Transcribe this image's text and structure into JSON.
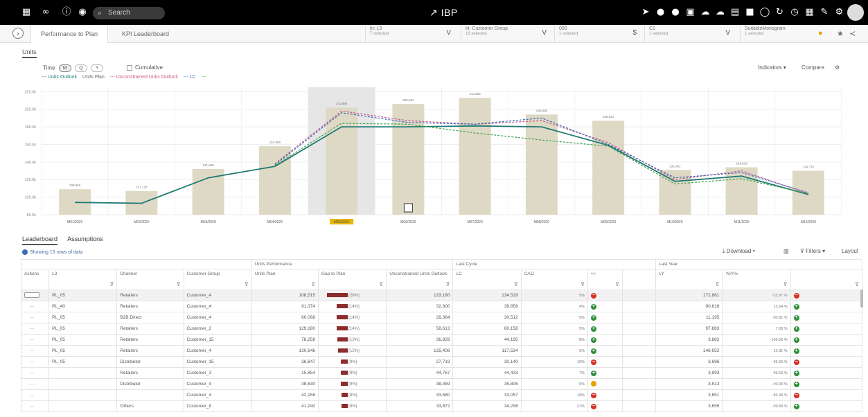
{
  "topbar": {
    "search_placeholder": "Search",
    "app_name": "IBP",
    "left_icons": [
      "grid-icon",
      "link-icon",
      "info-icon",
      "target-icon"
    ],
    "right_icons": [
      "send-icon",
      "circle-icon",
      "circle-icon",
      "doc-icon",
      "cloud-icon",
      "cloud-upload-icon",
      "file-icon",
      "screen-icon",
      "chat-icon",
      "refresh-icon",
      "clock-icon",
      "save-icon",
      "edit-icon",
      "settings-icon"
    ]
  },
  "tabs": [
    {
      "label": "Performance to Plan"
    },
    {
      "label": "KPI Leaderboard"
    }
  ],
  "filters": [
    {
      "label": "kt: L3",
      "value": "7 selected",
      "sym": "V"
    },
    {
      "label": "kt: Customer Group",
      "value": "18 selected",
      "sym": "V"
    },
    {
      "label": "000",
      "value": "1 selected",
      "sym": "$"
    },
    {
      "label": "C1",
      "value": "1 selected",
      "sym": "V"
    },
    {
      "label": "SuitableMonogram",
      "value": "1 selected",
      "sym": ""
    }
  ],
  "chart_section": {
    "tab": "Units",
    "time_label": "Time",
    "time_buttons": [
      "M",
      "Q",
      "Y"
    ],
    "cumulative": "Cumulative",
    "indicators": "Indicators",
    "compare": "Compare"
  },
  "legend": [
    "--- Units Outlook",
    "Units Plan",
    "--- Unconstrained Units Outlook",
    "--- LC",
    "---"
  ],
  "chart_data": {
    "type": "bar",
    "categories": [
      "M01/2020",
      "M02/2020",
      "M03/2020",
      "M04/2020",
      "M05/2020",
      "M06/2020",
      "M07/2020",
      "M08/2020",
      "M09/2020",
      "M10/2020",
      "M11/2020",
      "M12/2020"
    ],
    "bar_labels": [
      "108,960",
      "107,128",
      "131,885",
      "157,908",
      "201,888",
      "205,822",
      "212,554",
      "193,809",
      "186,821",
      "131,091",
      "133,618",
      "129,776"
    ],
    "ylim": [
      80,
      225
    ],
    "y_ticks": [
      "80.0k",
      "100.0k",
      "120.0k",
      "140.0k",
      "160.0k",
      "180.0k",
      "200.0k",
      "220.0k"
    ],
    "series": [
      {
        "name": "Units Plan",
        "values": [
          109,
          107,
          132,
          158,
          202,
          206,
          213,
          194,
          187,
          131,
          134,
          130
        ]
      },
      {
        "name": "Units Outlook",
        "values": [
          94,
          93,
          122,
          135,
          180,
          180,
          181,
          180,
          159,
          118,
          124,
          103
        ]
      },
      {
        "name": "Unconstrained Units Outlook",
        "values": [
          null,
          null,
          null,
          138,
          198,
          187,
          183,
          187,
          162,
          120,
          130,
          104
        ]
      },
      {
        "name": "LC",
        "values": [
          null,
          null,
          null,
          137,
          196,
          185,
          183,
          190,
          160,
          122,
          128,
          105
        ]
      },
      {
        "name": "",
        "values": [
          null,
          null,
          null,
          136,
          184,
          183,
          173,
          165,
          158,
          115,
          121,
          104
        ]
      }
    ],
    "highlight": "M05/2020",
    "colors": {
      "bar": "#ded9c5",
      "outlook": "#1f7a72",
      "unconstrained": "#c8578a",
      "lc": "#3b6ab8",
      "extra": "#3fa34d"
    }
  },
  "table_section": {
    "tabs": [
      "Leaderboard",
      "Assumptions"
    ],
    "showing": "Showing 15 rows of data",
    "download": "Download",
    "filters": "Filters",
    "layout": "Layout"
  },
  "table": {
    "groups": [
      "",
      "",
      "",
      "",
      "Units Performance",
      "",
      "",
      "Last Cycle",
      "",
      "",
      "",
      "Last Year",
      "",
      ""
    ],
    "columns": [
      "Actions",
      "L3",
      "Channel",
      "Customer Group",
      "Units Plan",
      "Gap to Plan",
      "Unconstrained Units Outlook",
      "LC",
      "CAO",
      "+/-",
      "",
      "LY",
      "YoY%",
      ""
    ],
    "rows": [
      {
        "l3": "PL_05",
        "ch": "Retailers",
        "cg": "Customer_4",
        "plan": "108,515",
        "gap": "(28%)",
        "gw": 30,
        "uno": "133,180",
        "lc": "134,528",
        "cao": "",
        "pm": "5%",
        "ind": "r",
        "ly": "172,881",
        "yoy": "-22.97 %",
        "yi": "r"
      },
      {
        "l3": "PL_40",
        "ch": "Retailers",
        "cg": "Customer_4",
        "plan": "81,374",
        "gap": "(14%)",
        "gw": 16,
        "uno": "32,800",
        "lc": "39,858",
        "cao": "",
        "pm": "4%",
        "ind": "g",
        "ly": "90,616",
        "yoy": "13.64 %",
        "yi": "g"
      },
      {
        "l3": "PL_05",
        "ch": "B2B Direct",
        "cg": "Customer_4",
        "plan": "60,068",
        "gap": "(14%)",
        "gw": 16,
        "uno": "28,364",
        "lc": "30,512",
        "cao": "",
        "pm": "9%",
        "ind": "g",
        "ly": "11,195",
        "yoy": "-90.81 %",
        "yi": "g"
      },
      {
        "l3": "PL_05",
        "ch": "Retailers",
        "cg": "Customer_2",
        "plan": "129,180",
        "gap": "(14%)",
        "gw": 16,
        "uno": "58,613",
        "lc": "60,158",
        "cao": "",
        "pm": "5%",
        "ind": "g",
        "ly": "97,883",
        "yoy": "7.68 %",
        "yi": "g"
      },
      {
        "l3": "PL_05",
        "ch": "Retailers",
        "cg": "Customer_15",
        "plan": "78,258",
        "gap": "(13%)",
        "gw": 15,
        "uno": "36,829",
        "lc": "44,195",
        "cao": "",
        "pm": "8%",
        "ind": "g",
        "ly": "3,882",
        "yoy": "-109.56 %",
        "yi": "g"
      },
      {
        "l3": "PL_05",
        "ch": "Retailers",
        "cg": "Customer_4",
        "plan": "130,646",
        "gap": "(12%)",
        "gw": 14,
        "uno": "135,408",
        "lc": "117,534",
        "cao": "",
        "pm": "5%",
        "ind": "g",
        "ly": "148,952",
        "yoy": "12.81 %",
        "yi": "g"
      },
      {
        "l3": "PL_05",
        "ch": "Distributor",
        "cg": "Customer_15",
        "plan": "36,847",
        "gap": "(9%)",
        "gw": 10,
        "uno": "27,719",
        "lc": "30,140",
        "cao": "",
        "pm": "19%",
        "ind": "r",
        "ly": "3,696",
        "yoy": "-99.90 %",
        "yi": "r"
      },
      {
        "l3": "",
        "ch": "Retailers",
        "cg": "Customer_3",
        "plan": "15,854",
        "gap": "(9%)",
        "gw": 10,
        "uno": "44,767",
        "lc": "44,433",
        "cao": "",
        "pm": "7%",
        "ind": "g",
        "ly": "3,993",
        "yoy": "-99.63 %",
        "yi": "g"
      },
      {
        "l3": "",
        "ch": "Distributor",
        "cg": "Customer_4",
        "plan": "38,630",
        "gap": "(9%)",
        "gw": 10,
        "uno": "38,359",
        "lc": "35,806",
        "cao": "",
        "pm": "0%",
        "ind": "y",
        "ly": "3,513",
        "yoy": "-99.90 %",
        "yi": "g"
      },
      {
        "l3": "",
        "ch": "",
        "cg": "Customer_4",
        "plan": "42,158",
        "gap": "(8%)",
        "gw": 9,
        "uno": "33,680",
        "lc": "33,057",
        "cao": "",
        "pm": "18%",
        "ind": "r",
        "ly": "3,651",
        "yoy": "-89.49 %",
        "yi": "r"
      },
      {
        "l3": "",
        "ch": "Others",
        "cg": "Customer_8",
        "plan": "41,240",
        "gap": "(8%)",
        "gw": 9,
        "uno": "33,872",
        "lc": "34,298",
        "cao": "",
        "pm": "21%",
        "ind": "r",
        "ly": "3,655",
        "yoy": "-99.89 %",
        "yi": "g"
      }
    ]
  }
}
